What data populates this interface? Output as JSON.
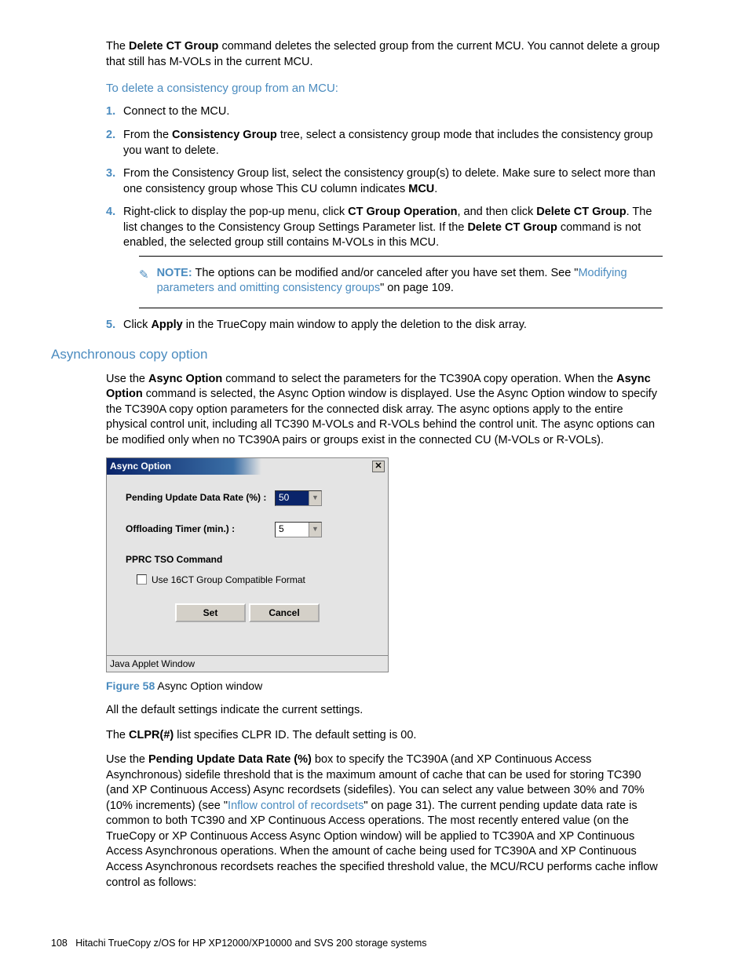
{
  "intro": {
    "p1_a": "The ",
    "p1_b": "Delete CT Group",
    "p1_c": " command deletes the selected group from the current MCU. You cannot delete a group that still has M-VOLs in the current MCU."
  },
  "sub1": "To delete a consistency group from an MCU:",
  "steps": {
    "s1": "Connect to the MCU.",
    "s2_a": "From the ",
    "s2_b": "Consistency Group",
    "s2_c": " tree, select a consistency group mode that includes the consistency group you want to delete.",
    "s3_a": "From the Consistency Group list, select the consistency group(s) to delete. Make sure to select more than one consistency group whose This CU column indicates ",
    "s3_b": "MCU",
    "s3_c": ".",
    "s4_a": "Right-click to display the pop-up menu, click ",
    "s4_b": "CT Group Operation",
    "s4_c": ", and then click ",
    "s4_d": "Delete CT Group",
    "s4_e": ". The list changes to the Consistency Group Settings Parameter list. If the ",
    "s4_f": "Delete CT Group",
    "s4_g": " command is not enabled, the selected group still contains M-VOLs in this MCU.",
    "s5_a": "Click ",
    "s5_b": "Apply",
    "s5_c": " in the TrueCopy main window to apply the deletion to the disk array."
  },
  "note": {
    "label": "NOTE:",
    "t1": "The options can be modified and/or canceled after you have set them. See \"",
    "link": "Modifying parameters and omitting consistency groups",
    "t2": "\" on page 109."
  },
  "h2": "Asynchronous copy option",
  "async": {
    "p1_a": "Use the ",
    "p1_b": "Async Option",
    "p1_c": " command to select the parameters for the TC390A copy operation. When the ",
    "p1_d": "Async Option",
    "p1_e": " command is selected, the Async Option window is displayed. Use the Async Option window to specify the TC390A copy option parameters for the connected disk array. The async options apply to the entire physical control unit, including all TC390 M-VOLs and R-VOLs behind the control unit. The async options can be modified only when no TC390A pairs or groups exist in the connected CU (M-VOLs or R-VOLs)."
  },
  "dialog": {
    "title": "Async Option",
    "pending_label": "Pending Update Data Rate (%) :",
    "pending_value": "50",
    "offload_label": "Offloading Timer (min.) :",
    "offload_value": "5",
    "pprc_label": "PPRC TSO Command",
    "chk_label": "Use 16CT Group Compatible Format",
    "btn_set": "Set",
    "btn_cancel": "Cancel",
    "status": "Java Applet Window"
  },
  "figcap": {
    "label": "Figure 58",
    "text": " Async Option window"
  },
  "post": {
    "p1": "All the default settings indicate the current settings.",
    "p2_a": "The ",
    "p2_b": "CLPR(#)",
    "p2_c": " list specifies CLPR ID. The default setting is 00.",
    "p3_a": "Use the ",
    "p3_b": "Pending Update Data Rate (%)",
    "p3_c": " box to specify the TC390A (and XP Continuous Access Asynchronous) sidefile threshold that is the maximum amount of cache that can be used for storing TC390 (and XP Continuous Access) Async recordsets (sidefiles). You can select any value between 30% and 70% (10% increments) (see \"",
    "p3_link": "Inflow control of recordsets",
    "p3_d": "\" on page 31). The current pending update data rate is common to both TC390 and XP Continuous Access operations. The most recently entered value (on the TrueCopy or XP Continuous Access Async Option window) will be applied to TC390A and XP Continuous Access Asynchronous operations. When the amount of cache being used for TC390A and XP Continuous Access Asynchronous recordsets reaches the specified threshold value, the MCU/RCU performs cache inflow control as follows:"
  },
  "footer": {
    "page": "108",
    "text": "Hitachi TrueCopy z/OS for HP XP12000/XP10000 and SVS 200 storage systems"
  }
}
